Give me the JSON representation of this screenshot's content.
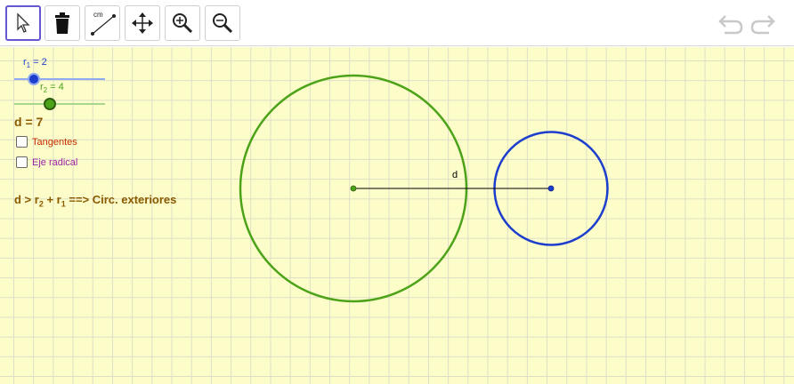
{
  "toolbar": {
    "tools": [
      {
        "name": "move-tool",
        "icon": "cursor-arrow-icon"
      },
      {
        "name": "delete-tool",
        "icon": "trash-icon"
      },
      {
        "name": "distance-tool",
        "icon": "distance-measure-icon",
        "label": "cm"
      },
      {
        "name": "move-graphics-view-tool",
        "icon": "four-arrows-icon"
      },
      {
        "name": "zoom-in-tool",
        "icon": "zoom-in-icon"
      },
      {
        "name": "zoom-out-tool",
        "icon": "zoom-out-icon"
      }
    ],
    "active_tool": "move-tool",
    "undo_icon": "undo-icon",
    "redo_icon": "redo-icon"
  },
  "sliders": {
    "r1": {
      "name": "r",
      "sub": "1",
      "text": " = 2",
      "value": 2,
      "color": "#1d3ecc"
    },
    "r2": {
      "name": "r",
      "sub": "2",
      "text": " = 4",
      "value": 4,
      "color": "#4ca319"
    }
  },
  "distance": {
    "label": "d = 7",
    "value": 7
  },
  "checkboxes": [
    {
      "label": "Tangentes",
      "checked": false,
      "color": "#c42b00"
    },
    {
      "label": "Eje radical",
      "checked": false,
      "color": "#9b1fa6"
    }
  ],
  "condition": {
    "prefix": "d > r",
    "sub1": "2",
    "middle": " + r",
    "sub2": "1",
    "suffix": " ==> Circ. exteriores"
  },
  "segment_label": "d",
  "colors": {
    "circle1": "#4ca319",
    "circle2": "#1d3ecc",
    "segment": "#000000",
    "grid_bg": "#fdfdc9",
    "condition_text": "#8a5a00"
  }
}
